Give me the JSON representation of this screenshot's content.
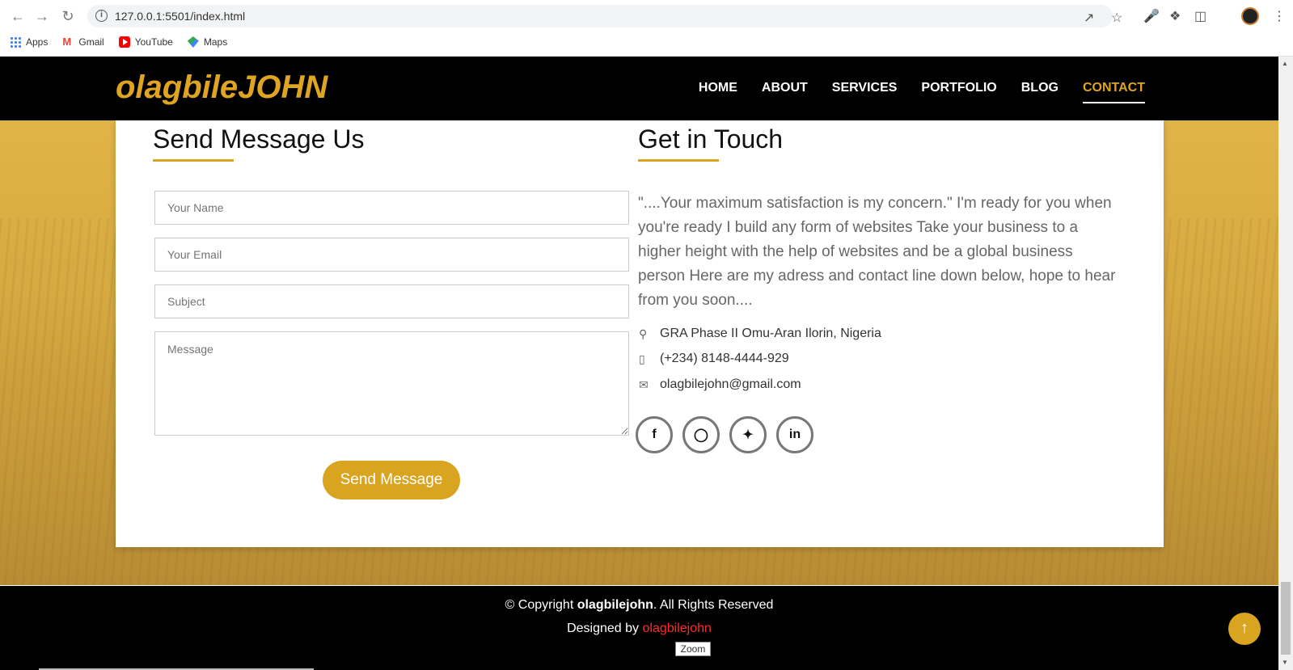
{
  "browser": {
    "url": "127.0.0.1:5501/index.html",
    "bookmarks": [
      {
        "label": "Apps",
        "icon": "apps-icon"
      },
      {
        "label": "Gmail",
        "icon": "gmail-icon"
      },
      {
        "label": "YouTube",
        "icon": "youtube-icon"
      },
      {
        "label": "Maps",
        "icon": "maps-icon"
      }
    ],
    "zoom_label": "Zoom"
  },
  "site": {
    "logo": "olagbileJOHN",
    "nav": [
      {
        "label": "HOME",
        "active": false
      },
      {
        "label": "ABOUT",
        "active": false
      },
      {
        "label": "SERVICES",
        "active": false
      },
      {
        "label": "PORTFOLIO",
        "active": false
      },
      {
        "label": "BLOG",
        "active": false
      },
      {
        "label": "CONTACT",
        "active": true
      }
    ]
  },
  "form": {
    "title": "Send Message Us",
    "name_placeholder": "Your Name",
    "email_placeholder": "Your Email",
    "subject_placeholder": "Subject",
    "message_placeholder": "Message",
    "submit_label": "Send Message"
  },
  "touch": {
    "title": "Get in Touch",
    "intro": "\"....Your maximum satisfaction is my concern.\" I'm ready for you when you're ready I build any form of websites Take your business to a higher height with the help of websites and be a global business person Here are my adress and contact line down below, hope to hear from you soon....",
    "address": "GRA Phase II Omu-Aran Ilorin, Nigeria",
    "phone": "(+234) 8148-4444-929",
    "email": "olagbilejohn@gmail.com",
    "socials": [
      "facebook-icon",
      "instagram-icon",
      "twitter-icon",
      "linkedin-icon"
    ]
  },
  "footer": {
    "copyright_prefix": "© Copyright ",
    "copyright_name": "olagbilejohn",
    "copyright_suffix": ". All Rights Reserved",
    "designed_prefix": "Designed by ",
    "designed_name": "olagbilejohn"
  },
  "colors": {
    "accent": "#d9a420",
    "header_bg": "#000000",
    "designer_link": "#ff2b2b"
  }
}
